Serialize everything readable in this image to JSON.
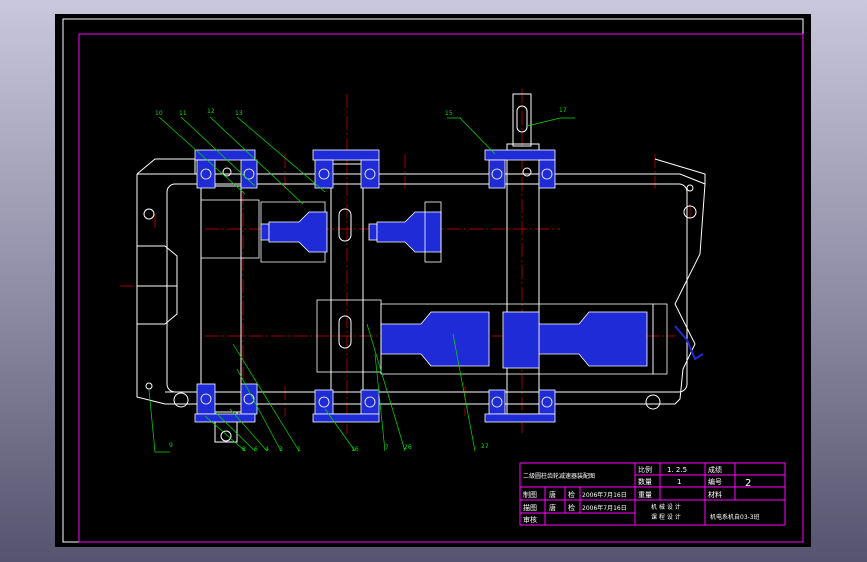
{
  "drawing": {
    "title": "二级圆柱齿轮减速器装配图",
    "part_labels": [
      "10",
      "11",
      "12",
      "13",
      "15",
      "17",
      "9",
      "8",
      "6",
      "4",
      "3",
      "1",
      "16",
      "7",
      "26",
      "27"
    ]
  },
  "title_block": {
    "scale_label": "比例",
    "scale_value": "1. 2.5",
    "qty_label": "数量",
    "qty_value": "1",
    "weight_label": "重量",
    "score_label": "成绩",
    "number_label": "编号",
    "number_value": "2",
    "material_label": "材料",
    "drawn_label": "制图",
    "drawn_name": "唐",
    "drawn_check": "检",
    "drawn_date": "2006年7月16日",
    "traced_label": "描图",
    "traced_name": "唐",
    "traced_check": "检",
    "traced_date": "2006年7月16日",
    "review_label": "审核",
    "course_line1": "机 械 设 计",
    "course_line2": "课 程 设 计",
    "class_info": "机电系机自03-3班"
  },
  "colors": {
    "frame": "#ff00ff",
    "outline": "#ffffff",
    "part": "#1f2bd6",
    "center_line": "#e00000",
    "leader": "#00e000"
  }
}
